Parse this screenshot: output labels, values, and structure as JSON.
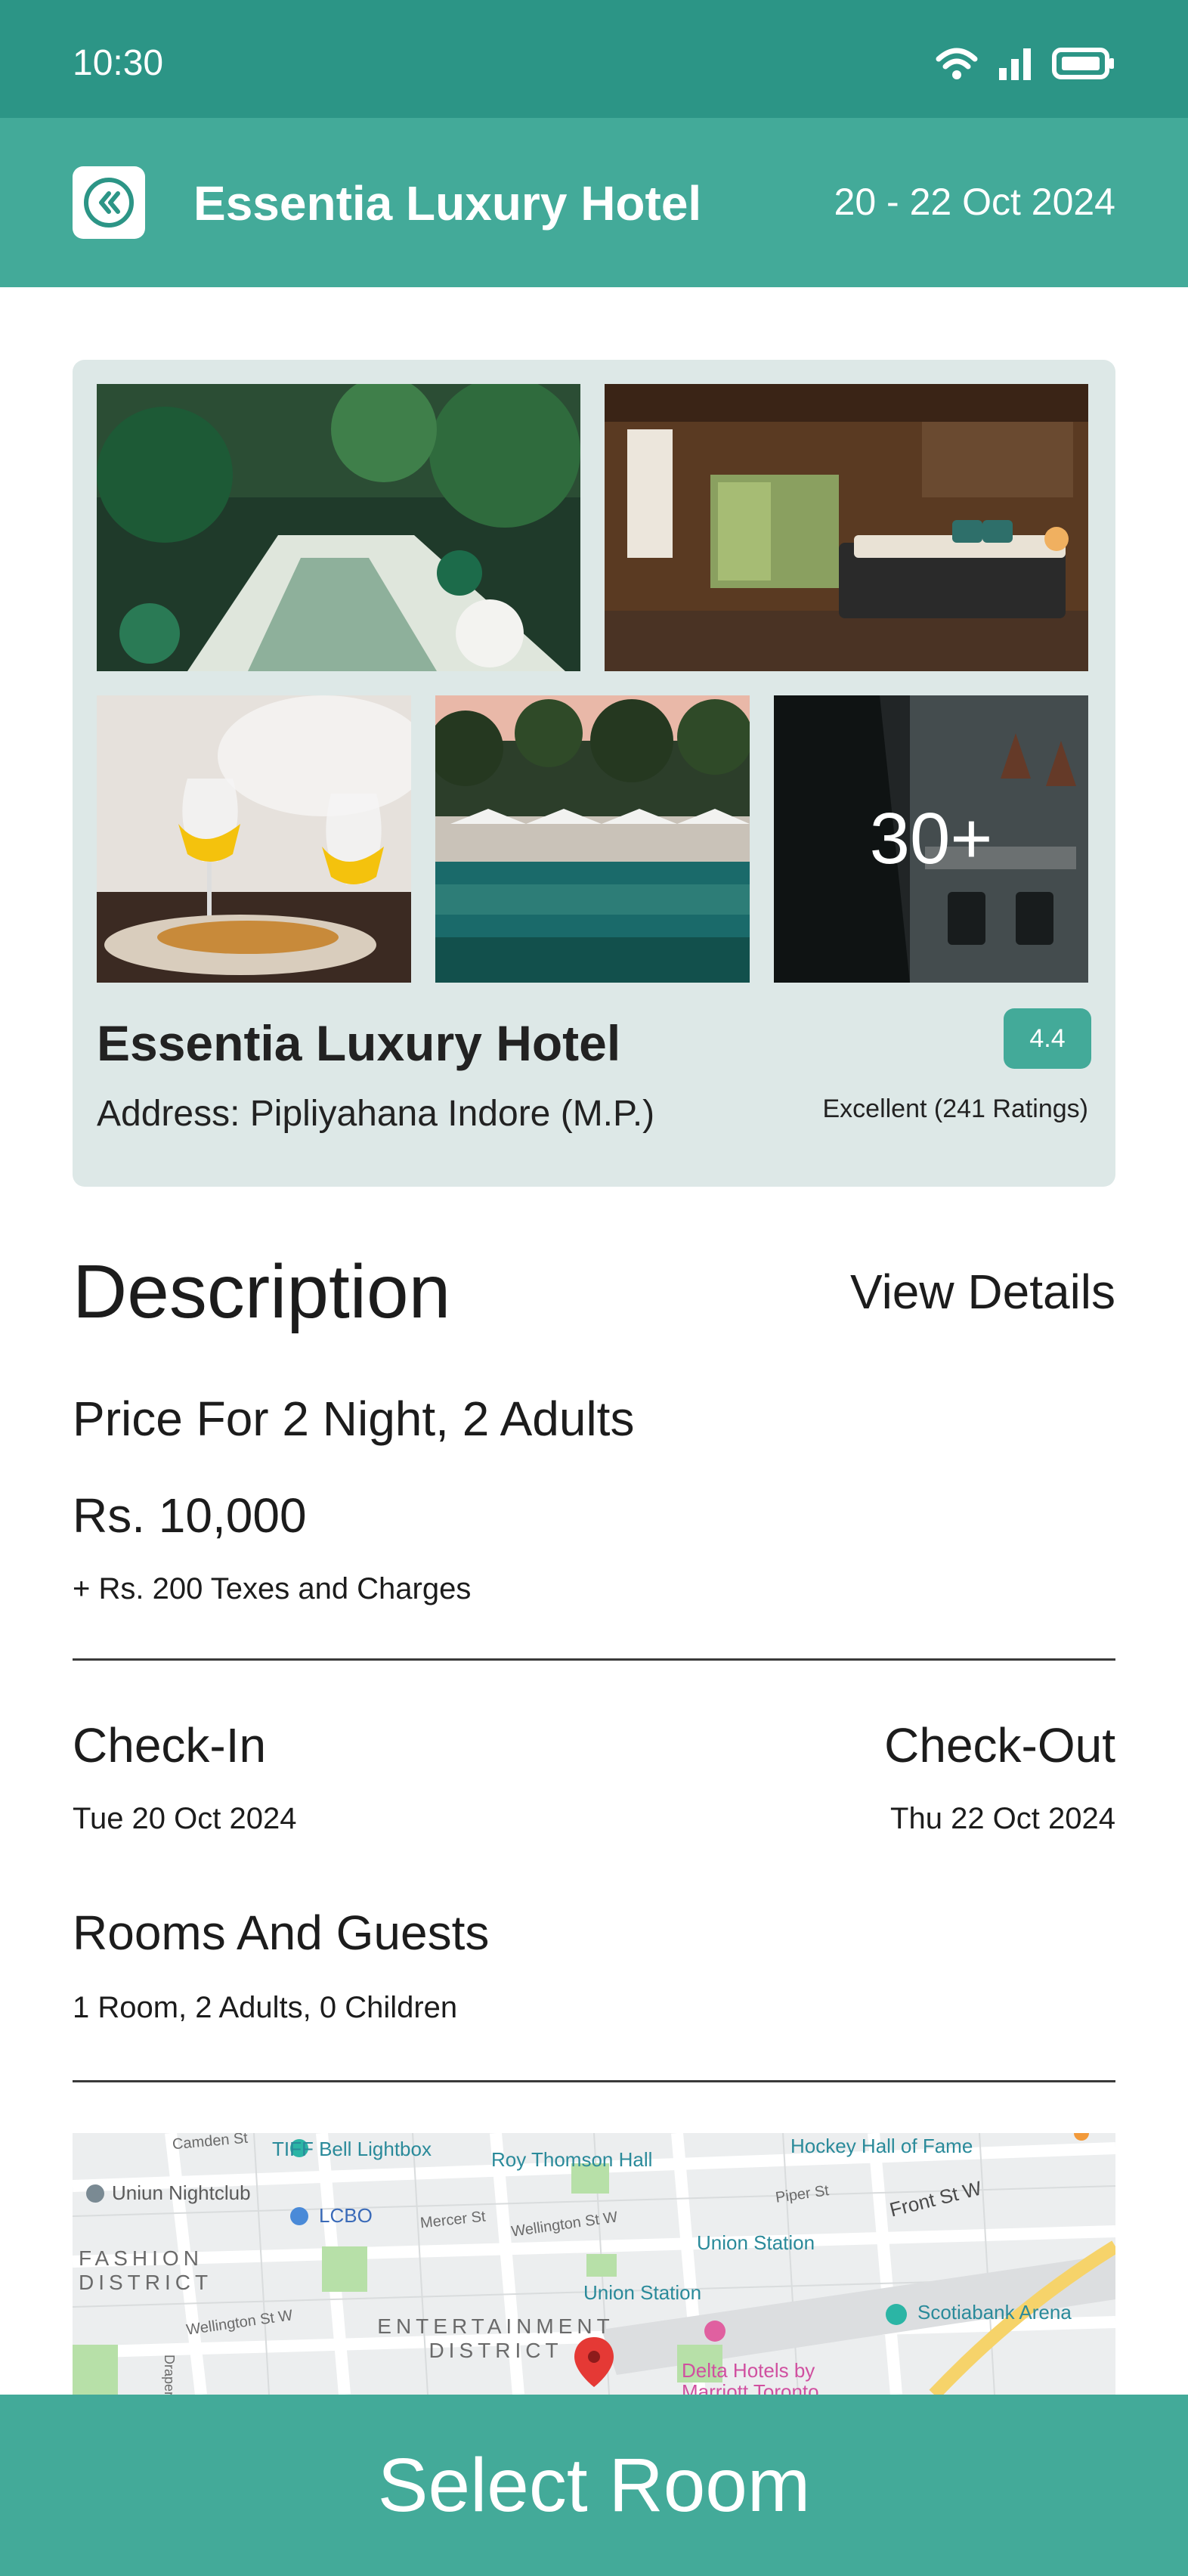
{
  "status_bar": {
    "time": "10:30"
  },
  "header": {
    "title": "Essentia Luxury Hotel",
    "dates": "20 - 22 Oct 2024"
  },
  "hotel": {
    "name": "Essentia Luxury Hotel",
    "address": "Address: Pipliyahana Indore (M.P.)",
    "rating": "4.4",
    "rating_text": "Excellent (241 Ratings)",
    "more_photos": "30+"
  },
  "description": {
    "title": "Description",
    "view_details": "View Details",
    "price_for": "Price For 2 Night, 2 Adults",
    "price": "Rs. 10,000",
    "taxes": "+ Rs. 200 Texes and Charges"
  },
  "stay": {
    "checkin_label": "Check-In",
    "checkin_date": "Tue 20 Oct 2024",
    "checkout_label": "Check-Out",
    "checkout_date": "Thu 22 Oct 2024",
    "rooms_label": "Rooms And Guests",
    "rooms_value": "1 Room, 2 Adults, 0 Children"
  },
  "map": {
    "labels": {
      "camden": "Camden St",
      "tiff": "TIFF Bell Lightbox",
      "roy": "Roy Thomson Hall",
      "hockey": "Hockey Hall of Fame",
      "nightclub": "Uniun Nightclub",
      "lcbo": "LCBO",
      "mercer": "Mercer St",
      "wellington1": "Wellington St W",
      "piper": "Piper St",
      "front": "Front St W",
      "fashion": "FASHION DISTRICT",
      "union1": "Union Station",
      "union2": "Union Station",
      "scotiabank": "Scotiabank Arena",
      "wellington2": "Wellington St W",
      "entertainment": "ENTERTAINMENT DISTRICT",
      "delta": "Delta Hotels by Marriott Toronto",
      "draper": "Draper"
    }
  },
  "cta": {
    "label": "Select Room"
  },
  "colors": {
    "primary": "#43aa99",
    "status": "#2c9586",
    "card": "#dde8e7"
  },
  "icons": [
    "wifi-icon",
    "signal-icon",
    "battery-icon",
    "double-chevron-left-icon",
    "map-pin-icon"
  ]
}
